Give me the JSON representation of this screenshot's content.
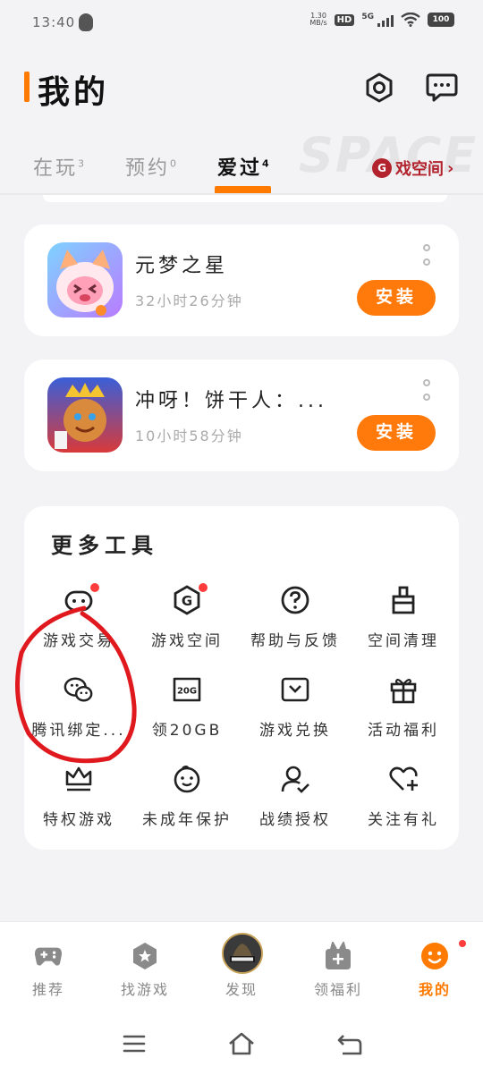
{
  "status_bar": {
    "time": "13:40",
    "net_speed": "1.30",
    "net_speed_unit": "MB/s",
    "hd": "HD",
    "network": "5G",
    "battery": "100"
  },
  "header": {
    "title": "我的",
    "settings_icon": "gear-icon",
    "message_icon": "message-icon"
  },
  "tabs": [
    {
      "label": "在玩",
      "count": "3"
    },
    {
      "label": "预约",
      "count": "0"
    },
    {
      "label": "爱过",
      "count": "4"
    }
  ],
  "active_tab": "爱过",
  "space_link": {
    "label": "戏空间",
    "watermark": "SPACE"
  },
  "games": [
    {
      "name": "元梦之星",
      "play_time": "32小时26分钟",
      "action": "安装"
    },
    {
      "name": "冲呀！饼干人：...",
      "play_time": "10小时58分钟",
      "action": "安装"
    }
  ],
  "tools": {
    "title": "更多工具",
    "items": [
      {
        "label": "游戏交易",
        "icon": "game-trade-icon",
        "badge": true
      },
      {
        "label": "游戏空间",
        "icon": "game-space-icon",
        "badge": true
      },
      {
        "label": "帮助与反馈",
        "icon": "help-icon",
        "badge": false
      },
      {
        "label": "空间清理",
        "icon": "broom-icon",
        "badge": false
      },
      {
        "label": "腾讯绑定...",
        "icon": "tencent-bind-icon",
        "badge": false
      },
      {
        "label": "领20GB",
        "icon": "sd-card-icon",
        "icon_text": "20G",
        "badge": false
      },
      {
        "label": "游戏兑换",
        "icon": "redeem-icon",
        "badge": false
      },
      {
        "label": "活动福利",
        "icon": "gift-icon",
        "badge": false
      },
      {
        "label": "特权游戏",
        "icon": "crown-icon",
        "badge": false
      },
      {
        "label": "未成年保护",
        "icon": "child-face-icon",
        "badge": false
      },
      {
        "label": "战绩授权",
        "icon": "user-check-icon",
        "badge": false
      },
      {
        "label": "关注有礼",
        "icon": "heart-plus-icon",
        "badge": false
      }
    ]
  },
  "bottom_nav": [
    {
      "label": "推荐",
      "icon": "gamepad-icon"
    },
    {
      "label": "找游戏",
      "icon": "star-hex-icon"
    },
    {
      "label": "发现",
      "icon": "discover-game-icon"
    },
    {
      "label": "领福利",
      "icon": "welfare-bag-icon"
    },
    {
      "label": "我的",
      "icon": "smile-face-icon"
    }
  ],
  "colors": {
    "accent": "#ff7a00",
    "badge": "#ff3b3b",
    "annotation": "#e0191f",
    "space_brand": "#b2232d"
  }
}
